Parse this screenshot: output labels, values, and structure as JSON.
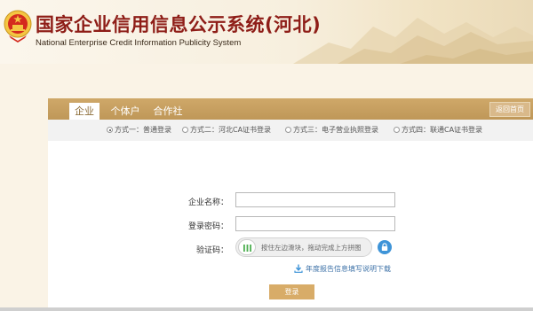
{
  "header": {
    "title": "国家企业信用信息公示系统(河北)",
    "subtitle": "National Enterprise Credit Information Publicity System",
    "emblem_icon": "national-emblem-icon"
  },
  "tabs": [
    {
      "label": "企业",
      "active": true
    },
    {
      "label": "个体户",
      "active": false
    },
    {
      "label": "合作社",
      "active": false
    }
  ],
  "back_button": "返回首页",
  "login_methods": [
    {
      "label": "方式一：普通登录",
      "selected": true
    },
    {
      "label": "方式二：河北CA证书登录",
      "selected": false
    },
    {
      "label": "方式三：电子营业执照登录",
      "selected": false
    },
    {
      "label": "方式四：联通CA证书登录",
      "selected": false
    }
  ],
  "form": {
    "company_name_label": "企业名称：",
    "company_name_value": "",
    "password_label": "登录密码：",
    "password_value": "",
    "captcha_label": "验证码：",
    "slider_text": "按住左边滑块，拖动完成上方拼图",
    "slider_icon": "drag-handle-icon",
    "lock_icon": "lock-icon"
  },
  "download_link": "年度报告信息填写说明下载",
  "download_icon": "download-icon",
  "login_button": "登录",
  "colors": {
    "brand_red": "#8e1d17",
    "tab_bar": "#c9a46a",
    "login_button": "#d8ac68",
    "link_blue": "#3f73a8"
  }
}
